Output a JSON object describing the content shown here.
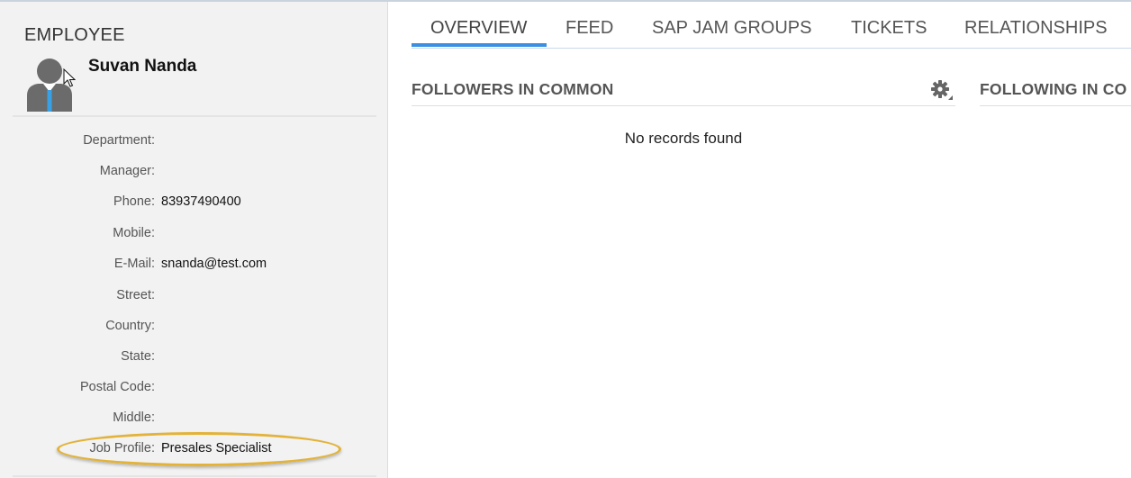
{
  "sidebar": {
    "heading": "EMPLOYEE",
    "name": "Suvan Nanda",
    "fields": [
      {
        "label": "Department:",
        "value": ""
      },
      {
        "label": "Manager:",
        "value": ""
      },
      {
        "label": "Phone:",
        "value": "83937490400"
      },
      {
        "label": "Mobile:",
        "value": ""
      },
      {
        "label": "E-Mail:",
        "value": "snanda@test.com"
      },
      {
        "label": "Street:",
        "value": ""
      },
      {
        "label": "Country:",
        "value": ""
      },
      {
        "label": "State:",
        "value": ""
      },
      {
        "label": "Postal Code:",
        "value": ""
      },
      {
        "label": "Middle:",
        "value": ""
      },
      {
        "label": "Job Profile:",
        "value": "Presales Specialist"
      }
    ]
  },
  "tabs": [
    {
      "label": "OVERVIEW",
      "active": true
    },
    {
      "label": "FEED",
      "active": false
    },
    {
      "label": "SAP JAM GROUPS",
      "active": false
    },
    {
      "label": "TICKETS",
      "active": false
    },
    {
      "label": "RELATIONSHIPS",
      "active": false
    }
  ],
  "sections": {
    "followers_title": "FOLLOWERS IN COMMON",
    "following_title": "FOLLOWING IN CO",
    "empty_message": "No records found"
  },
  "colors": {
    "accent": "#3b8fe0",
    "highlight": "#e3b236"
  },
  "icons": {
    "avatar": "person-avatar-icon",
    "settings": "gear-icon",
    "cursor": "mouse-pointer-icon"
  }
}
